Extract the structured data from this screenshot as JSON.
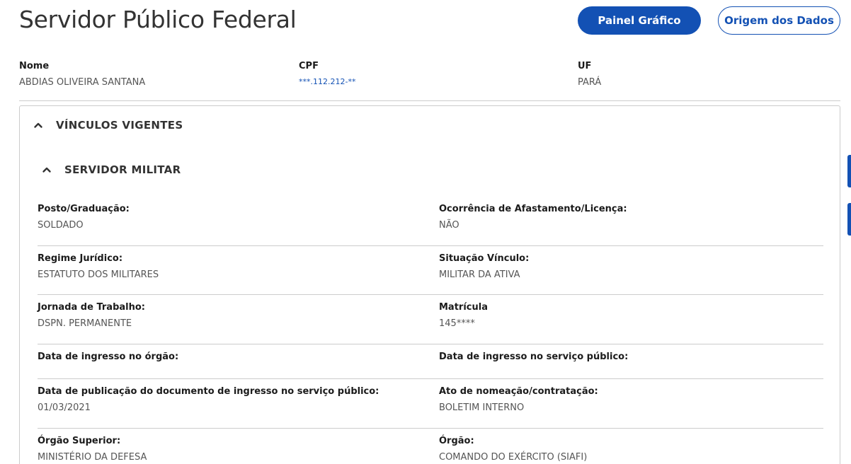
{
  "header": {
    "title": "Servidor Público Federal",
    "primary_button_label": "Painel Gráfico",
    "secondary_button_label": "Origem dos Dados"
  },
  "identity": {
    "name_label": "Nome",
    "name_value": "ABDIAS OLIVEIRA SANTANA",
    "cpf_label": "CPF",
    "cpf_value": "***.112.212-**",
    "uf_label": "UF",
    "uf_value": "PARÁ"
  },
  "sections": {
    "vinculos_title": "VÍNCULOS VIGENTES",
    "servidor_title": "SERVIDOR MILITAR"
  },
  "fields": [
    {
      "label": "Posto/Graduação:",
      "value": "SOLDADO"
    },
    {
      "label": "Ocorrência de Afastamento/Licença:",
      "value": "NÃO"
    },
    {
      "label": "Regime Jurídico:",
      "value": "ESTATUTO DOS MILITARES"
    },
    {
      "label": "Situação Vínculo:",
      "value": "MILITAR DA ATIVA"
    },
    {
      "label": "Jornada de Trabalho:",
      "value": "DSPN. PERMANENTE"
    },
    {
      "label": "Matrícula",
      "value": "145****"
    },
    {
      "label": "Data de ingresso no órgão:",
      "value": ""
    },
    {
      "label": "Data de ingresso no serviço público:",
      "value": ""
    },
    {
      "label": "Data de publicação do documento de ingresso no serviço público:",
      "value": "01/03/2021"
    },
    {
      "label": "Ato de nomeação/contratação:",
      "value": "BOLETIM INTERNO"
    },
    {
      "label": "Órgão Superior:",
      "value": "MINISTÉRIO DA DEFESA"
    },
    {
      "label": "Órgão:",
      "value": "COMANDO DO EXÉRCITO (SIAFI)"
    }
  ],
  "icons": {
    "collapse": "chevron-up-icon"
  },
  "colors": {
    "brand_blue": "#1351b4",
    "text_dark": "#333333",
    "text_value": "#555555",
    "divider": "#cccccc"
  }
}
